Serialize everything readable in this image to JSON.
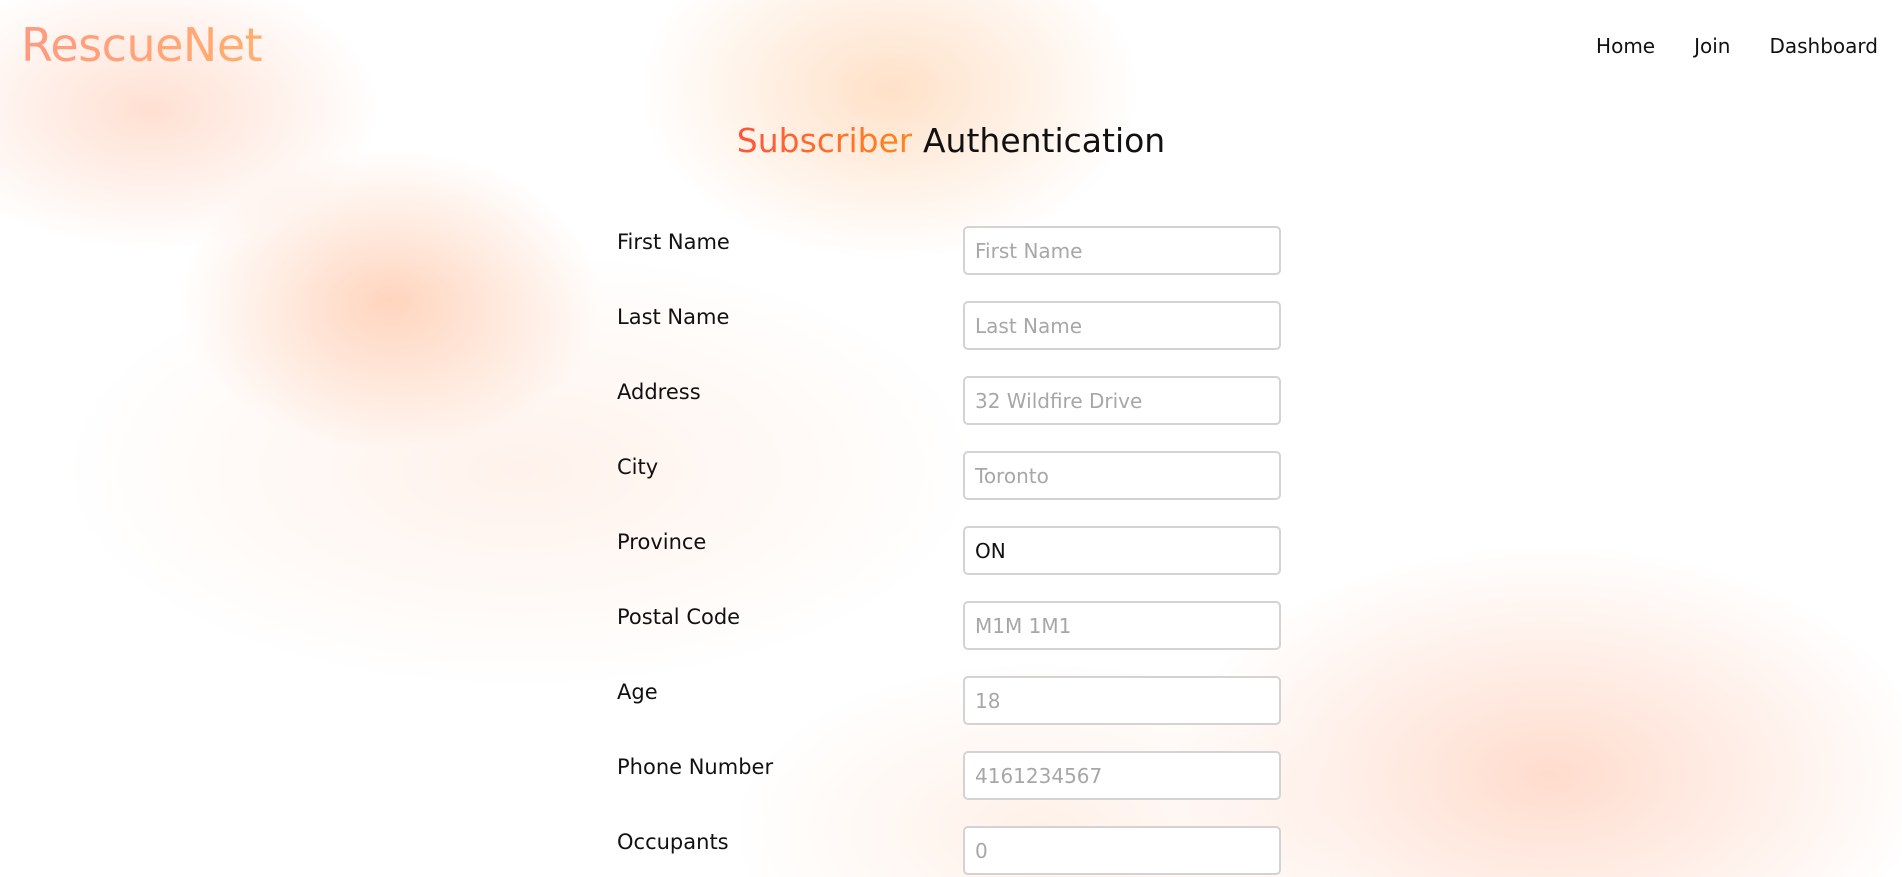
{
  "brand": {
    "name": "RescueNet"
  },
  "nav": {
    "home": "Home",
    "join": "Join",
    "dashboard": "Dashboard"
  },
  "page": {
    "title_accent": "Subscriber",
    "title_main": "Authentication"
  },
  "form": {
    "fields": [
      {
        "label": "First Name",
        "value": "",
        "placeholder": "First Name"
      },
      {
        "label": "Last Name",
        "value": "",
        "placeholder": "Last Name"
      },
      {
        "label": "Address",
        "value": "",
        "placeholder": "32 Wildfire Drive"
      },
      {
        "label": "City",
        "value": "",
        "placeholder": "Toronto"
      },
      {
        "label": "Province",
        "value": "ON",
        "placeholder": ""
      },
      {
        "label": "Postal Code",
        "value": "",
        "placeholder": "M1M 1M1"
      },
      {
        "label": "Age",
        "value": "",
        "placeholder": "18"
      },
      {
        "label": "Phone Number",
        "value": "",
        "placeholder": "4161234567"
      },
      {
        "label": "Occupants",
        "value": "",
        "placeholder": "0"
      }
    ]
  },
  "colors": {
    "brand_gradient_start": "#ff9a82",
    "brand_gradient_end": "#ffae6f",
    "title_accent_start": "#ff5438",
    "title_accent_end": "#ff861c",
    "text": "#111111",
    "placeholder": "#a7a7a7",
    "input_border": "#d3d3d3"
  }
}
